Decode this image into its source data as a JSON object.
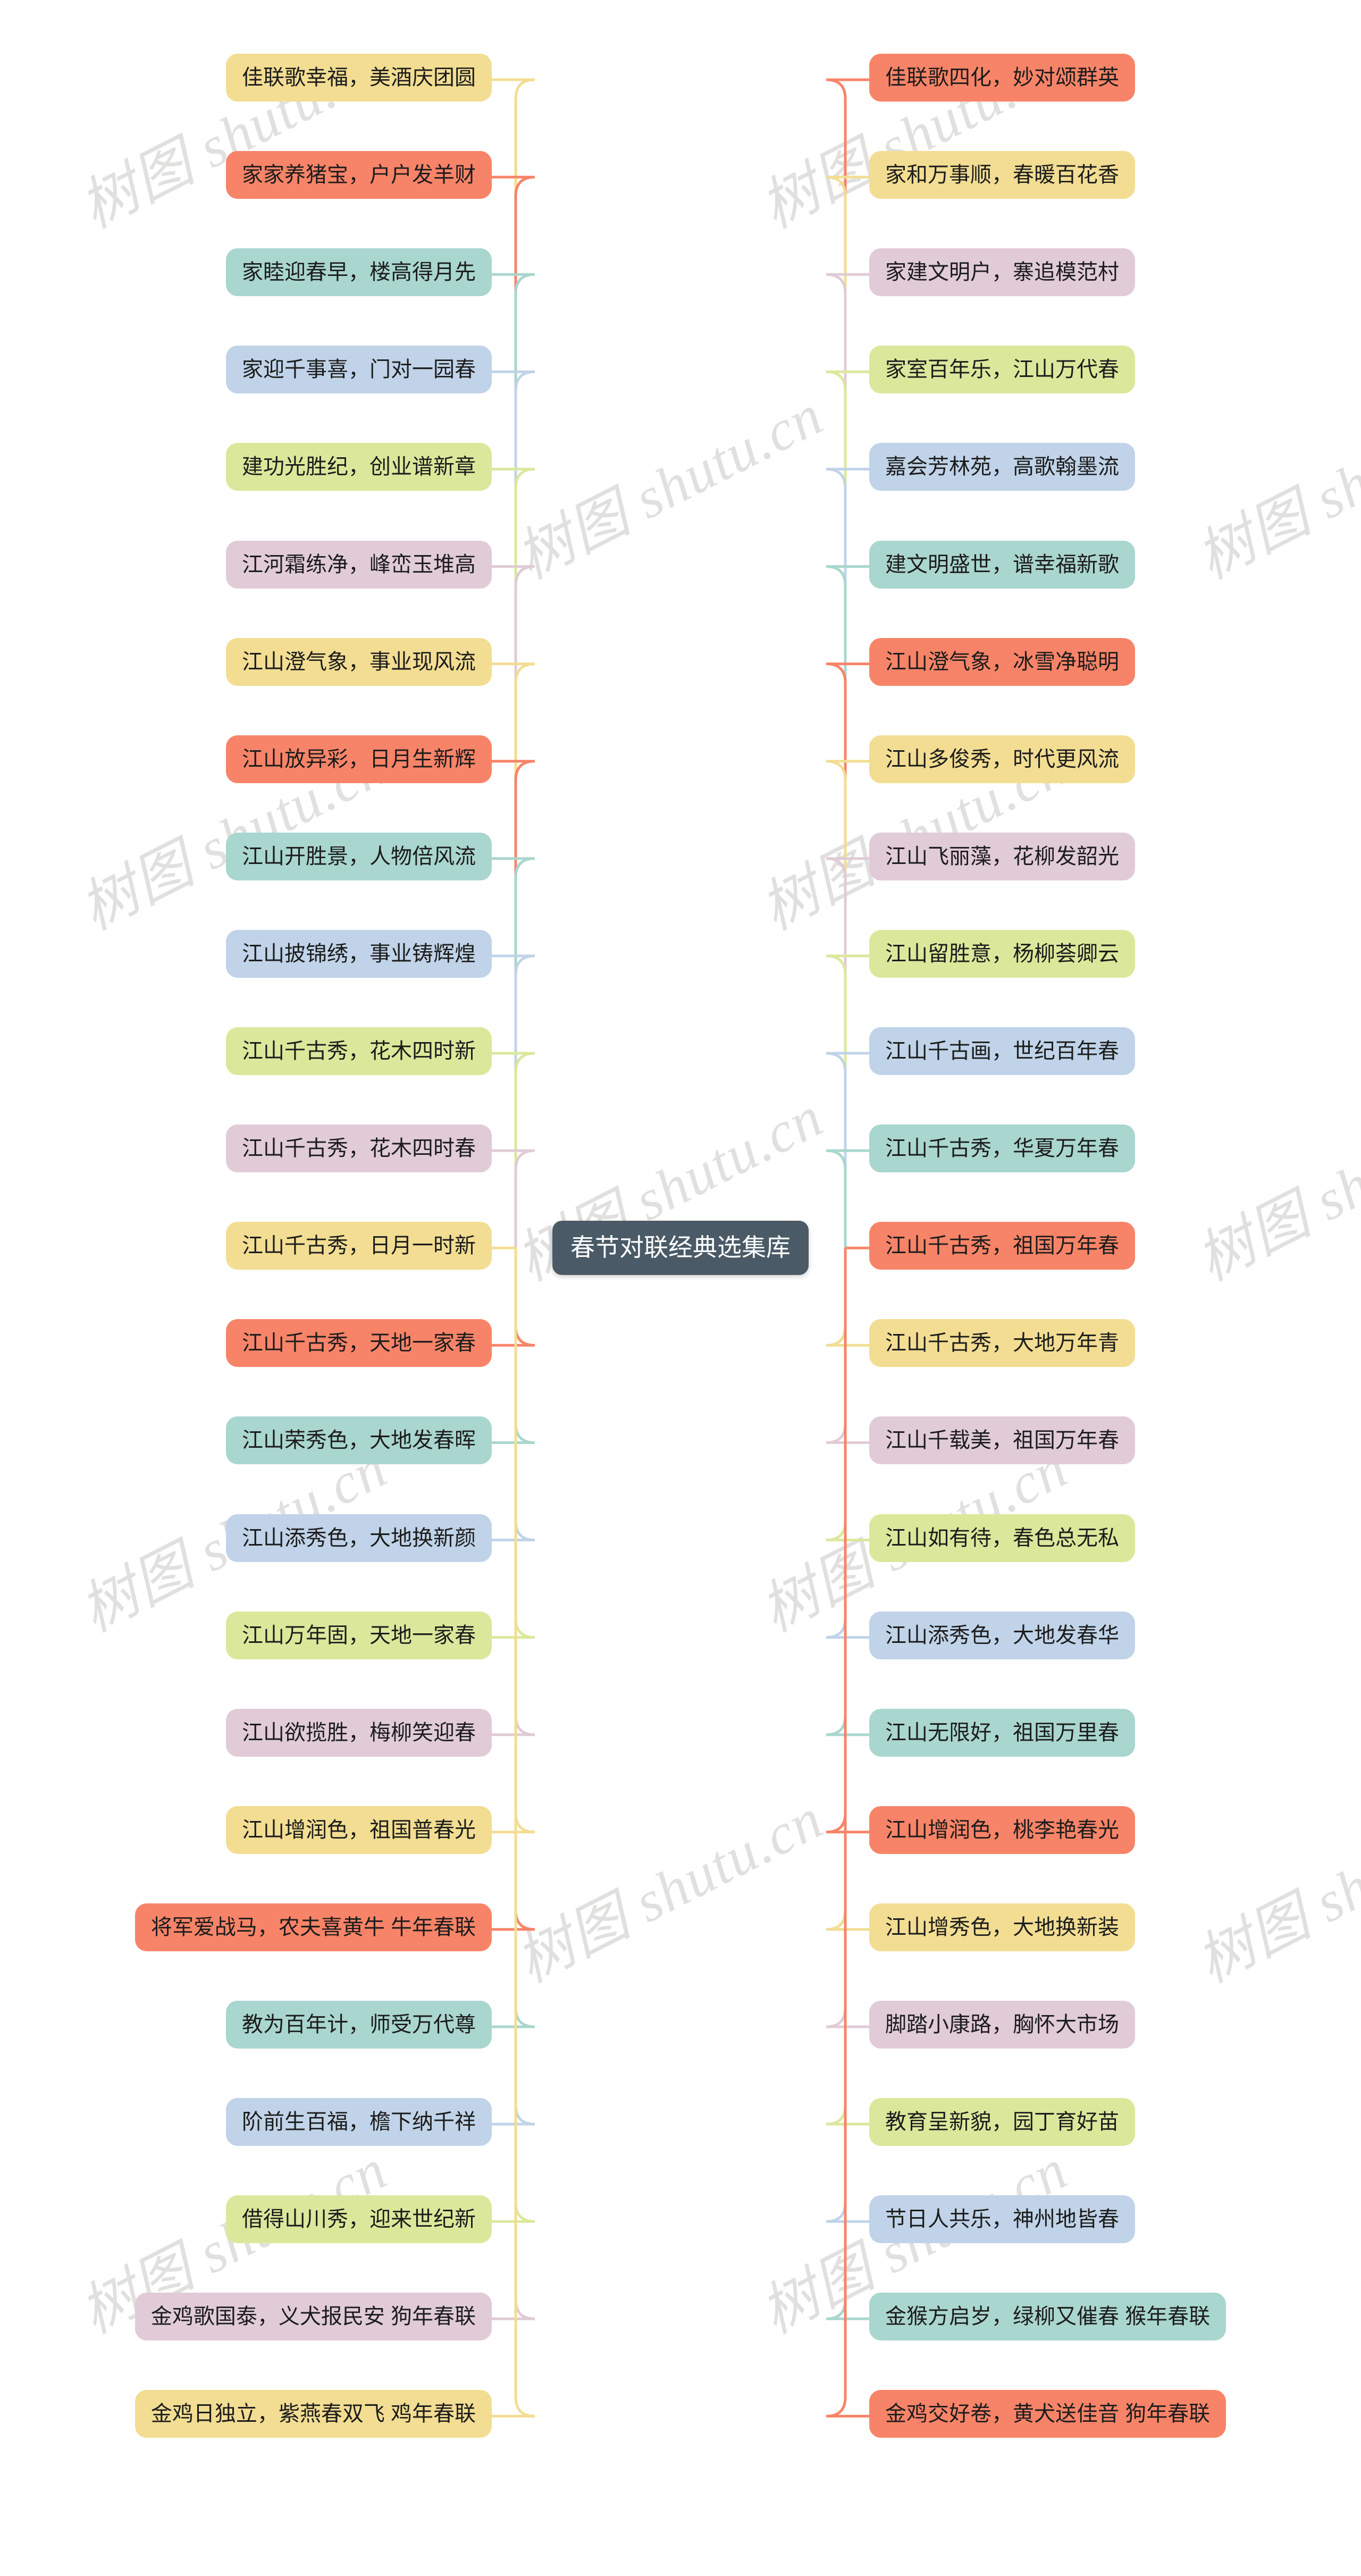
{
  "root": {
    "label": "春节对联经典选集库",
    "color": "#4a5a66",
    "text_color": "#ffffff"
  },
  "palette": {
    "yellow": "#f2dd92",
    "coral": "#f78468",
    "teal": "#a9d6ce",
    "blue": "#c0d3e8",
    "lime": "#dbe89b",
    "mauve": "#e0cbd6"
  },
  "watermark": {
    "text": "树图 shutu.cn"
  },
  "left_branch": [
    {
      "label": "佳联歌幸福，美酒庆团圆",
      "color": "yellow"
    },
    {
      "label": "家家养猪宝，户户发羊财",
      "color": "coral"
    },
    {
      "label": "家睦迎春早，楼高得月先",
      "color": "teal"
    },
    {
      "label": "家迎千事喜，门对一园春",
      "color": "blue"
    },
    {
      "label": "建功光胜纪，创业谱新章",
      "color": "lime"
    },
    {
      "label": "江河霜练净，峰峦玉堆高",
      "color": "mauve"
    },
    {
      "label": "江山澄气象，事业现风流",
      "color": "yellow"
    },
    {
      "label": "江山放异彩，日月生新辉",
      "color": "coral"
    },
    {
      "label": "江山开胜景，人物倍风流",
      "color": "teal"
    },
    {
      "label": "江山披锦绣，事业铸辉煌",
      "color": "blue"
    },
    {
      "label": "江山千古秀，花木四时新",
      "color": "lime"
    },
    {
      "label": "江山千古秀，花木四时春",
      "color": "mauve"
    },
    {
      "label": "江山千古秀，日月一时新",
      "color": "yellow"
    },
    {
      "label": "江山千古秀，天地一家春",
      "color": "coral"
    },
    {
      "label": "江山荣秀色，大地发春晖",
      "color": "teal"
    },
    {
      "label": "江山添秀色，大地换新颜",
      "color": "blue"
    },
    {
      "label": "江山万年固，天地一家春",
      "color": "lime"
    },
    {
      "label": "江山欲揽胜，梅柳笑迎春",
      "color": "mauve"
    },
    {
      "label": "江山增润色，祖国普春光",
      "color": "yellow"
    },
    {
      "label": "将军爱战马，农夫喜黄牛 牛年春联",
      "color": "coral"
    },
    {
      "label": "教为百年计，师受万代尊",
      "color": "teal"
    },
    {
      "label": "阶前生百福，檐下纳千祥",
      "color": "blue"
    },
    {
      "label": "借得山川秀，迎来世纪新",
      "color": "lime"
    },
    {
      "label": "金鸡歌国泰，义犬报民安 狗年春联",
      "color": "mauve"
    },
    {
      "label": "金鸡日独立，紫燕春双飞 鸡年春联",
      "color": "yellow"
    }
  ],
  "right_branch": [
    {
      "label": "佳联歌四化，妙对颂群英",
      "color": "coral"
    },
    {
      "label": "家和万事顺，春暖百花香",
      "color": "yellow"
    },
    {
      "label": "家建文明户，寨追模范村",
      "color": "mauve"
    },
    {
      "label": "家室百年乐，江山万代春",
      "color": "lime"
    },
    {
      "label": "嘉会芳林苑，高歌翰墨流",
      "color": "blue"
    },
    {
      "label": "建文明盛世，谱幸福新歌",
      "color": "teal"
    },
    {
      "label": "江山澄气象，冰雪净聪明",
      "color": "coral"
    },
    {
      "label": "江山多俊秀，时代更风流",
      "color": "yellow"
    },
    {
      "label": "江山飞丽藻，花柳发韶光",
      "color": "mauve"
    },
    {
      "label": "江山留胜意，杨柳荟卿云",
      "color": "lime"
    },
    {
      "label": "江山千古画，世纪百年春",
      "color": "blue"
    },
    {
      "label": "江山千古秀，华夏万年春",
      "color": "teal"
    },
    {
      "label": "江山千古秀，祖国万年春",
      "color": "coral"
    },
    {
      "label": "江山千古秀，大地万年青",
      "color": "yellow"
    },
    {
      "label": "江山千载美，祖国万年春",
      "color": "mauve"
    },
    {
      "label": "江山如有待，春色总无私",
      "color": "lime"
    },
    {
      "label": "江山添秀色，大地发春华",
      "color": "blue"
    },
    {
      "label": "江山无限好，祖国万里春",
      "color": "teal"
    },
    {
      "label": "江山增润色，桃李艳春光",
      "color": "coral"
    },
    {
      "label": "江山增秀色，大地换新装",
      "color": "yellow"
    },
    {
      "label": "脚踏小康路，胸怀大市场",
      "color": "mauve"
    },
    {
      "label": "教育呈新貌，园丁育好苗",
      "color": "lime"
    },
    {
      "label": "节日人共乐，神州地皆春",
      "color": "blue"
    },
    {
      "label": "金猴方启岁，绿柳又催春 猴年春联",
      "color": "teal"
    },
    {
      "label": "金鸡交好卷，黄犬送佳音 狗年春联",
      "color": "coral"
    }
  ]
}
